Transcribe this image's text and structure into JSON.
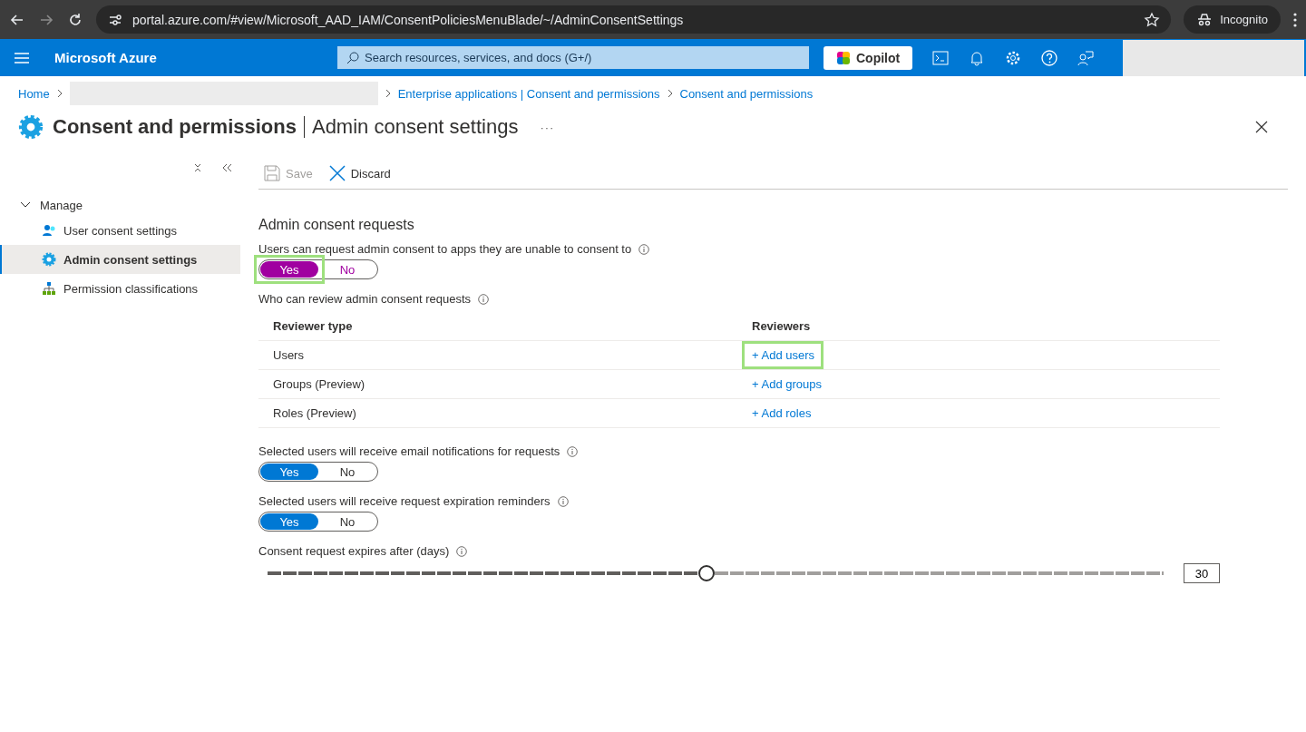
{
  "browser": {
    "url": "portal.azure.com/#view/Microsoft_AAD_IAM/ConsentPoliciesMenuBlade/~/AdminConsentSettings",
    "profile": "Incognito"
  },
  "topbar": {
    "brand": "Microsoft Azure",
    "search": {
      "placeholder": "Search resources, services, and docs (G+/)"
    },
    "copilot": "Copilot"
  },
  "breadcrumb": [
    {
      "label": "Home"
    },
    {
      "label": "Enterprise applications | Consent and permissions"
    },
    {
      "label": "Consent and permissions"
    }
  ],
  "page": {
    "title": "Consent and permissions",
    "subtitle": "Admin consent settings",
    "more": "···"
  },
  "sidebar": {
    "group": {
      "label": "Manage",
      "expanded": true,
      "items": [
        {
          "label": "User consent settings",
          "kind": "user",
          "selected": false
        },
        {
          "label": "Admin consent settings",
          "kind": "gear",
          "selected": true
        },
        {
          "label": "Permission classifications",
          "kind": "tree",
          "selected": false
        }
      ]
    }
  },
  "toolbar": [
    {
      "label": "Save",
      "kind": "save",
      "disabled": true
    },
    {
      "label": "Discard",
      "kind": "discard",
      "disabled": false
    }
  ],
  "section_title": "Admin consent requests",
  "request_toggle": {
    "label": "Users can request admin consent to apps they are unable to consent to",
    "modified": true,
    "highlighted": true,
    "options": [
      {
        "label": "Yes",
        "selected": true
      },
      {
        "label": "No",
        "selected": false
      }
    ]
  },
  "reviewers": {
    "label": "Who can review admin consent requests",
    "columns": [
      "Reviewer type",
      "Reviewers"
    ],
    "rows": [
      {
        "type": "Users",
        "action": "+ Add users",
        "highlighted": true
      },
      {
        "type": "Groups (Preview)",
        "action": "+ Add groups",
        "highlighted": false
      },
      {
        "type": "Roles (Preview)",
        "action": "+ Add roles",
        "highlighted": false
      }
    ]
  },
  "toggles": [
    {
      "label": "Selected users will receive email notifications for requests",
      "modified": false,
      "highlighted": false,
      "options": [
        {
          "label": "Yes",
          "selected": true
        },
        {
          "label": "No",
          "selected": false
        }
      ]
    },
    {
      "label": "Selected users will receive request expiration reminders",
      "modified": false,
      "highlighted": false,
      "options": [
        {
          "label": "Yes",
          "selected": true
        },
        {
          "label": "No",
          "selected": false
        }
      ]
    }
  ],
  "expiry": {
    "label": "Consent request expires after (days)",
    "level": 0.49,
    "value": "30"
  }
}
